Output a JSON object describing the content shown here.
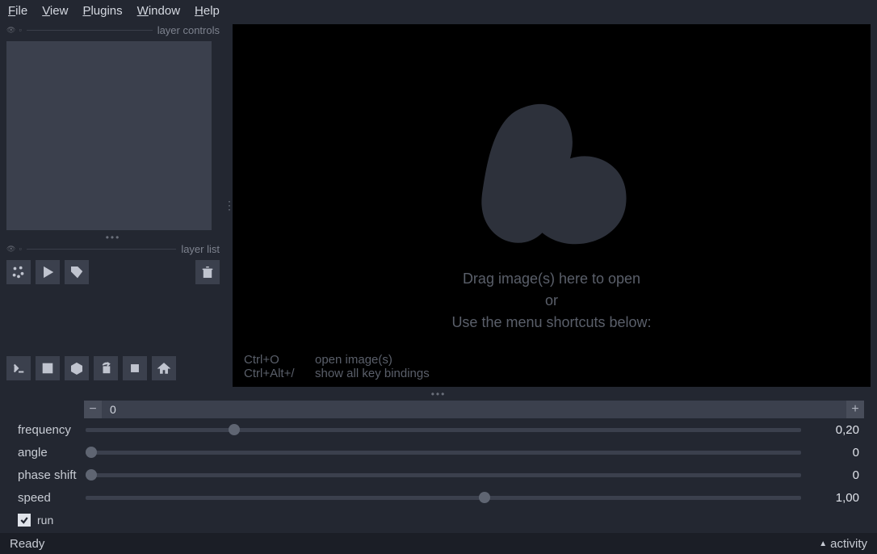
{
  "menu": {
    "file": "File",
    "view": "View",
    "plugins": "Plugins",
    "window": "Window",
    "help": "Help"
  },
  "panels": {
    "layer_controls": "layer controls",
    "layer_list": "layer list"
  },
  "canvas": {
    "line1": "Drag image(s) here to open",
    "line2": "or",
    "line3": "Use the menu shortcuts below:",
    "shortcuts": [
      {
        "key": "Ctrl+O",
        "desc": "open image(s)"
      },
      {
        "key": "Ctrl+Alt+/",
        "desc": "show all key bindings"
      }
    ]
  },
  "spinner": {
    "value": "0"
  },
  "sliders": {
    "frequency": {
      "label": "frequency",
      "value": "0,20",
      "pos": 20
    },
    "angle": {
      "label": "angle",
      "value": "0",
      "pos": 0
    },
    "phase": {
      "label": "phase shift",
      "value": "0",
      "pos": 0
    },
    "speed": {
      "label": "speed",
      "value": "1,00",
      "pos": 55
    }
  },
  "run": {
    "label": "run",
    "checked": true
  },
  "status": {
    "left": "Ready",
    "right": "activity"
  }
}
